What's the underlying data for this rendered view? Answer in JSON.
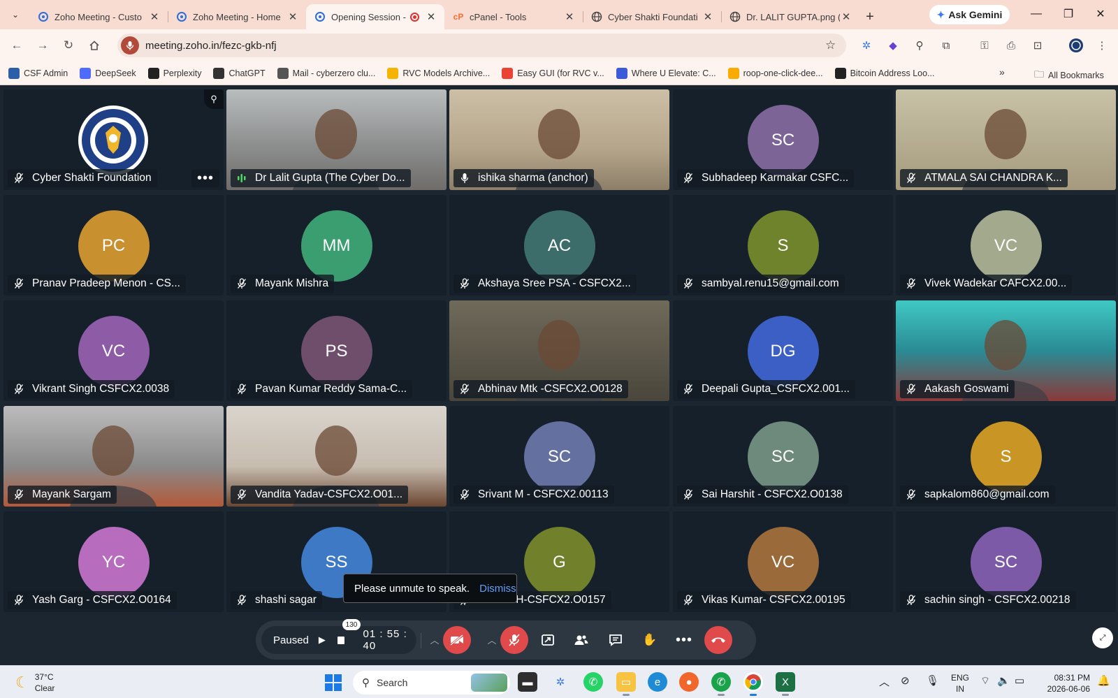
{
  "browser": {
    "tabs": [
      {
        "title": "Zoho Meeting - Custo",
        "icon": "zoho-meeting-icon"
      },
      {
        "title": "Zoho Meeting - Home",
        "icon": "zoho-meeting-icon"
      },
      {
        "title": "Opening Session -",
        "icon": "zoho-meeting-icon",
        "active": true,
        "recording": true
      },
      {
        "title": "cPanel - Tools",
        "icon": "cpanel-icon"
      },
      {
        "title": "Cyber Shakti Foundati",
        "icon": "globe-icon"
      },
      {
        "title": "Dr. LALIT GUPTA.png (",
        "icon": "globe-icon"
      }
    ],
    "ask_gemini": "Ask Gemini",
    "url": "meeting.zoho.in/fezc-gkb-nfj",
    "bookmarks": [
      {
        "label": "CSF Admin",
        "icon": "csf-icon",
        "color": "#2b5fa8"
      },
      {
        "label": "DeepSeek",
        "icon": "deepseek-icon",
        "color": "#4d6bfe"
      },
      {
        "label": "Perplexity",
        "icon": "perplexity-icon",
        "color": "#222222"
      },
      {
        "label": "ChatGPT",
        "icon": "chatgpt-icon",
        "color": "#333333"
      },
      {
        "label": "Mail - cyberzero clu...",
        "icon": "mail-icon",
        "color": "#555555"
      },
      {
        "label": "RVC Models Archive...",
        "icon": "drive-icon",
        "color": "#f4b400"
      },
      {
        "label": "Easy GUI (for RVC v...",
        "icon": "google-icon",
        "color": "#ea4335"
      },
      {
        "label": "Where U Elevate: C...",
        "icon": "elevate-icon",
        "color": "#3b5bdb"
      },
      {
        "label": "roop-one-click-dee...",
        "icon": "colab-icon",
        "color": "#f9ab00"
      },
      {
        "label": "Bitcoin Address Loo...",
        "icon": "bitcoin-icon",
        "color": "#222222"
      }
    ],
    "all_bookmarks": "All Bookmarks"
  },
  "meeting": {
    "participants": [
      {
        "name": "Cyber Shakti Foundation",
        "type": "logo",
        "pinned": true
      },
      {
        "name": "Dr Lalit Gupta (The Cyber Do...",
        "type": "video",
        "speaking": true
      },
      {
        "name": "ishika sharma (anchor)",
        "type": "video",
        "mic": "on"
      },
      {
        "name": "Subhadeep Karmakar CSFC...",
        "type": "avatar",
        "initials": "SC",
        "color": "#7d6496"
      },
      {
        "name": "ATMALA SAI CHANDRA K...",
        "type": "video"
      },
      {
        "name": "Pranav Pradeep Menon - CS...",
        "type": "avatar",
        "initials": "PC",
        "color": "#c8902f"
      },
      {
        "name": "Mayank Mishra",
        "type": "avatar",
        "initials": "MM",
        "color": "#3b9e70"
      },
      {
        "name": "Akshaya Sree PSA - CSFCX2...",
        "type": "avatar",
        "initials": "AC",
        "color": "#3d6d6b"
      },
      {
        "name": "sambyal.renu15@gmail.com",
        "type": "avatar",
        "initials": "S",
        "color": "#6f822c"
      },
      {
        "name": "Vivek Wadekar CAFCX2.00...",
        "type": "avatar",
        "initials": "VC",
        "color": "#a2a98c"
      },
      {
        "name": "Vikrant Singh CSFCX2.0038",
        "type": "avatar",
        "initials": "VC",
        "color": "#8e5ba6"
      },
      {
        "name": "Pavan Kumar Reddy Sama-C...",
        "type": "avatar",
        "initials": "PS",
        "color": "#6e4e6a"
      },
      {
        "name": "Abhinav Mtk -CSFCX2.O0128",
        "type": "video"
      },
      {
        "name": "Deepali Gupta_CSFCX2.001...",
        "type": "avatar",
        "initials": "DG",
        "color": "#3b5fc4"
      },
      {
        "name": "Aakash Goswami",
        "type": "video"
      },
      {
        "name": "Mayank Sargam",
        "type": "video"
      },
      {
        "name": "Vandita Yadav-CSFCX2.O01...",
        "type": "video"
      },
      {
        "name": "Srivant M - CSFCX2.00113",
        "type": "avatar",
        "initials": "SC",
        "color": "#6470a0"
      },
      {
        "name": "Sai Harshit - CSFCX2.O0138",
        "type": "avatar",
        "initials": "SC",
        "color": "#6e8a7c"
      },
      {
        "name": "sapkalom860@gmail.com",
        "type": "avatar",
        "initials": "S",
        "color": "#c99626"
      },
      {
        "name": "Yash Garg - CSFCX2.O0164",
        "type": "avatar",
        "initials": "YC",
        "color": "#b76cbd"
      },
      {
        "name": "shashi sagar",
        "type": "avatar",
        "initials": "SS",
        "color": "#3e79c6"
      },
      {
        "name": "GRANTH-CSFCX2.O0157",
        "type": "avatar",
        "initials": "G",
        "color": "#71812b"
      },
      {
        "name": "Vikas Kumar- CSFCX2.00195",
        "type": "avatar",
        "initials": "VC",
        "color": "#9a6a3a"
      },
      {
        "name": "sachin singh - CSFCX2.00218",
        "type": "avatar",
        "initials": "SC",
        "color": "#7c5aa8"
      }
    ],
    "toast": {
      "message": "Please unmute to speak.",
      "action": "Dismiss"
    },
    "controls": {
      "recording_status": "Paused",
      "timer": "01 : 55 : 40",
      "participants_count": "130"
    }
  },
  "taskbar": {
    "weather": {
      "temp": "37°C",
      "condition": "Clear"
    },
    "search_placeholder": "Search",
    "language": {
      "line1": "ENG",
      "line2": "IN"
    },
    "clock": {
      "time": "08:31 PM",
      "date": "2026-06-06"
    }
  }
}
